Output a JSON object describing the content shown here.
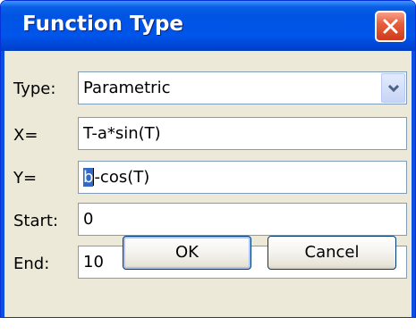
{
  "dialog": {
    "title": "Function Type",
    "close_label": "×"
  },
  "type_field": {
    "label": "Type:",
    "value": "Parametric"
  },
  "x_field": {
    "label": "X=",
    "value": "T-a*sin(T)"
  },
  "y_field": {
    "label": "Y=",
    "selected_text": "b",
    "value_rest": "-cos(T)"
  },
  "start_field": {
    "label": "Start:",
    "value": "0"
  },
  "end_field": {
    "label": "End:",
    "value": "10"
  },
  "buttons": {
    "ok_label": "OK",
    "cancel_label": "Cancel"
  },
  "icons": {
    "close": "close-icon",
    "dropdown": "chevron-down-icon"
  },
  "colors": {
    "titlebar": "#0054e3",
    "close_button": "#e5603c",
    "selection": "#316ac5",
    "dialog_background": "#ece9d8"
  }
}
